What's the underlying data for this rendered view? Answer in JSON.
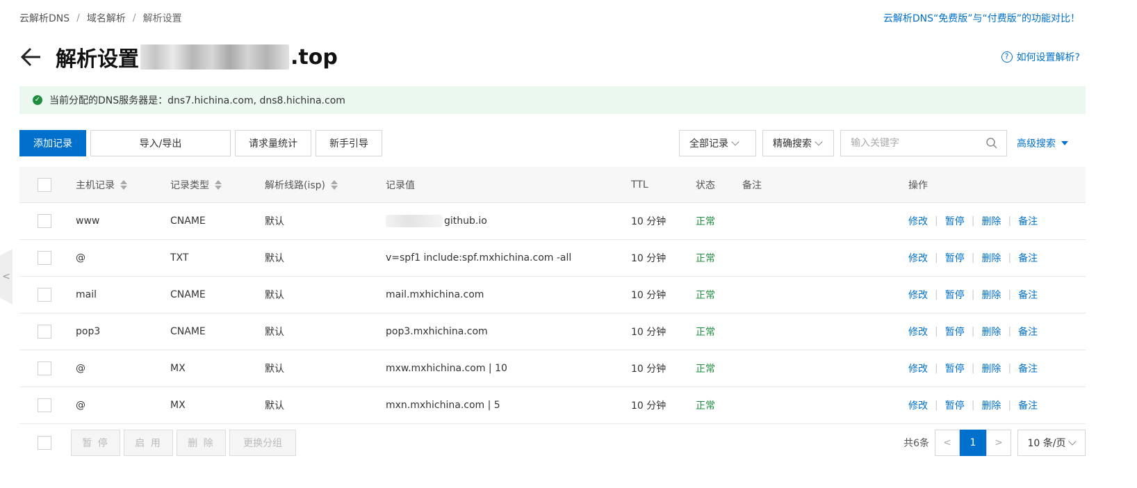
{
  "breadcrumb": {
    "items": [
      "云解析DNS",
      "域名解析",
      "解析设置"
    ],
    "sep": "/"
  },
  "top_link": "云解析DNS“免费版”与“付费版”的功能对比！",
  "page": {
    "title_prefix": "解析设置",
    "title_suffix": ".top"
  },
  "help_link": "如何设置解析?",
  "help_icon_glyph": "?",
  "dns_banner": {
    "text": "当前分配的DNS服务器是：dns7.hichina.com, dns8.hichina.com",
    "icon": "check-circle-icon"
  },
  "toolbar": {
    "add": "添加记录",
    "import_export": "导入/导出",
    "stats": "请求量统计",
    "guide": "新手引导"
  },
  "filters": {
    "record_filter": "全部记录",
    "search_mode": "精确搜索",
    "search_placeholder": "输入关键字",
    "advanced": "高级搜索"
  },
  "table": {
    "headers": {
      "host": "主机记录",
      "type": "记录类型",
      "line": "解析线路(isp)",
      "value": "记录值",
      "ttl": "TTL",
      "status": "状态",
      "remark": "备注",
      "ops": "操作"
    },
    "rows": [
      {
        "host": "www",
        "type": "CNAME",
        "line": "默认",
        "value": "github.io",
        "ttl": "10 分钟",
        "status": "正常"
      },
      {
        "host": "@",
        "type": "TXT",
        "line": "默认",
        "value": "v=spf1 include:spf.mxhichina.com -all",
        "ttl": "10 分钟",
        "status": "正常"
      },
      {
        "host": "mail",
        "type": "CNAME",
        "line": "默认",
        "value": "mail.mxhichina.com",
        "ttl": "10 分钟",
        "status": "正常"
      },
      {
        "host": "pop3",
        "type": "CNAME",
        "line": "默认",
        "value": "pop3.mxhichina.com",
        "ttl": "10 分钟",
        "status": "正常"
      },
      {
        "host": "@",
        "type": "MX",
        "line": "默认",
        "value": "mxw.mxhichina.com | 10",
        "ttl": "10 分钟",
        "status": "正常"
      },
      {
        "host": "@",
        "type": "MX",
        "line": "默认",
        "value": "mxn.mxhichina.com | 5",
        "ttl": "10 分钟",
        "status": "正常"
      }
    ],
    "ops": {
      "edit": "修改",
      "pause": "暂停",
      "delete": "删除",
      "remark": "备注",
      "sep": "|"
    }
  },
  "footer": {
    "buttons": {
      "pause": "暂 停",
      "enable": "启 用",
      "delete": "删 除",
      "change_group": "更换分组"
    },
    "total": "共6条",
    "prev_glyph": "<",
    "current_page": "1",
    "next_glyph": ">",
    "page_size": "10 条/页"
  },
  "side_tab_glyph": "<",
  "colors": {
    "accent": "#0070cc",
    "success": "#1e8e3e",
    "banner_bg": "#ebf8f0"
  }
}
